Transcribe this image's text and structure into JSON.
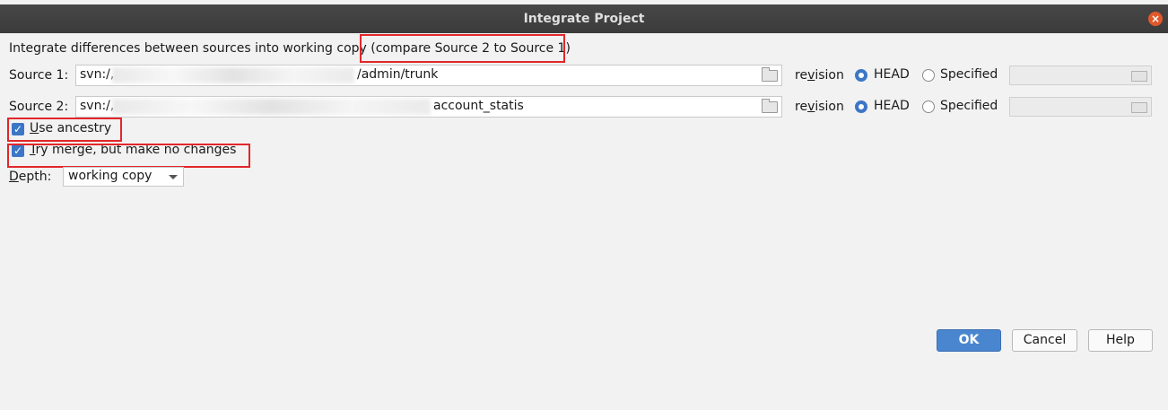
{
  "window": {
    "title": "Integrate Project"
  },
  "description": {
    "prefix": "Integrate differences between sources into working copy ",
    "highlight": "(compare Source 2 to Source 1)"
  },
  "source1": {
    "label": "Source 1:",
    "url_prefix": "svn:/,",
    "url_suffix": "/admin/trunk",
    "revision_label": "revision",
    "head_label": "HEAD",
    "specified_label": "Specified",
    "selected": "HEAD"
  },
  "source2": {
    "label": "Source 2:",
    "url_prefix": "svn:/,",
    "url_suffix": "account_statis",
    "revision_label": "revision",
    "head_label": "HEAD",
    "specified_label": "Specified",
    "selected": "HEAD"
  },
  "options": {
    "use_ancestry": {
      "label": "Use ancestry",
      "checked": true
    },
    "try_merge": {
      "label": "Try merge, but make no changes",
      "checked": true
    }
  },
  "depth": {
    "label": "Depth:",
    "value": "working copy"
  },
  "buttons": {
    "ok": "OK",
    "cancel": "Cancel",
    "help": "Help"
  },
  "colors": {
    "accent": "#3c76c6",
    "highlight_box": "#e2262b",
    "titlebar": "#3f3f3f"
  },
  "icons": {
    "close": "close-icon",
    "browse": "folder-icon",
    "dropdown": "chevron-down-icon"
  }
}
